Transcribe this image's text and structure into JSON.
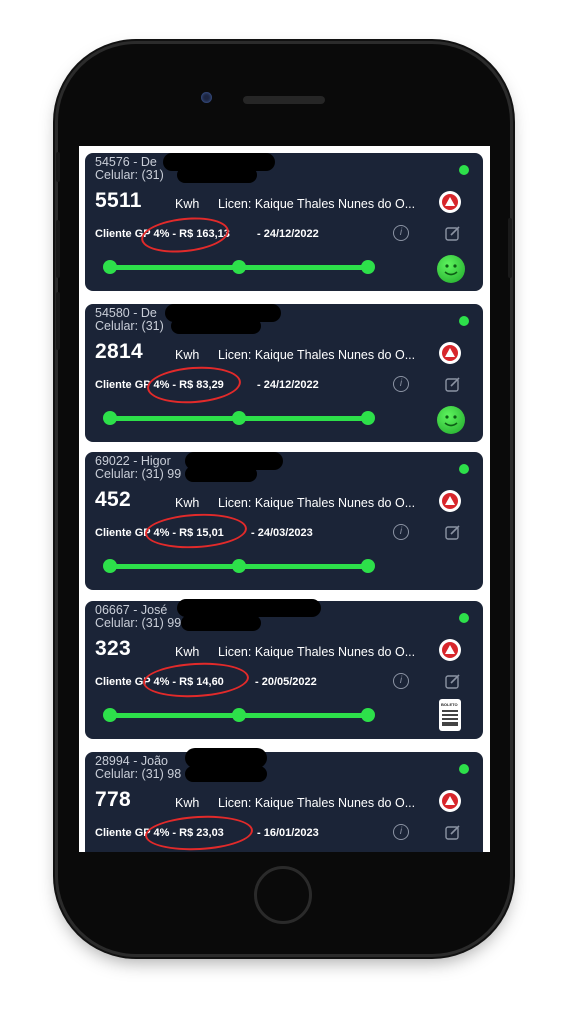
{
  "cards": [
    {
      "id_name": "54576 - De",
      "phone": "Celular: (31)",
      "kwh": "5511",
      "kwh_unit": "Kwh",
      "licen": "Licen: Kaique Thales Nunes do O...",
      "client_info": "Cliente GP 4% - R$ 163,13",
      "date": "- 24/12/2022",
      "bottom_icon": "smiley-icon"
    },
    {
      "id_name": "54580 - De",
      "phone": "Celular: (31)",
      "kwh": "2814",
      "kwh_unit": "Kwh",
      "licen": "Licen: Kaique Thales Nunes do O...",
      "client_info": "Cliente GP 4% - R$ 83,29",
      "date": "- 24/12/2022",
      "bottom_icon": "smiley-icon"
    },
    {
      "id_name": "69022 - Higor",
      "phone": "Celular: (31) 99",
      "kwh": "452",
      "kwh_unit": "Kwh",
      "licen": "Licen: Kaique Thales Nunes do O...",
      "client_info": "Cliente GP 4% - R$ 15,01",
      "date": "- 24/03/2023",
      "bottom_icon": "none"
    },
    {
      "id_name": "06667 - José",
      "phone": "Celular: (31) 99",
      "kwh": "323",
      "kwh_unit": "Kwh",
      "licen": "Licen: Kaique Thales Nunes do O...",
      "client_info": "Cliente GP 4% - R$ 14,60",
      "date": "- 20/05/2022",
      "bottom_icon": "boleto-icon",
      "boleto_label": "BOLETO"
    },
    {
      "id_name": "28994 - João",
      "phone": "Celular: (31) 98",
      "kwh": "778",
      "kwh_unit": "Kwh",
      "licen": "Licen: Kaique Thales Nunes do O...",
      "client_info": "Cliente GP 4% - R$ 23,03",
      "date": "- 16/01/2023",
      "bottom_icon": "none"
    }
  ],
  "colors": {
    "card_bg": "#1b2437",
    "accent_green": "#2de04a",
    "annotation_red": "#e22a2a"
  }
}
